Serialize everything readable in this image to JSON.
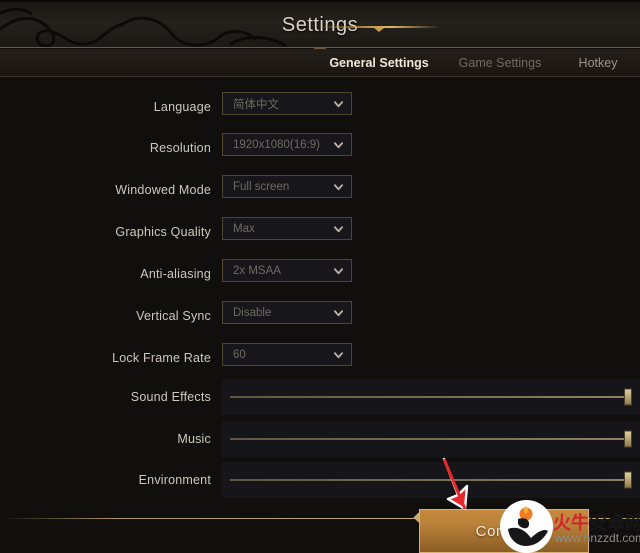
{
  "header": {
    "title": "Settings",
    "swirl_icon": "ornamental-swirl"
  },
  "tabs": [
    {
      "label": "General Settings",
      "active": true
    },
    {
      "label": "Game Settings",
      "active": false
    },
    {
      "label": "Hotkey",
      "active": false
    }
  ],
  "dropdown_rows": [
    {
      "label": "Language",
      "value": "简体中文",
      "icon": "chevron-down-icon"
    },
    {
      "label": "Resolution",
      "value": "1920x1080(16:9)",
      "icon": "chevron-down-icon"
    },
    {
      "label": "Windowed Mode",
      "value": "Full screen",
      "icon": "chevron-down-icon"
    },
    {
      "label": "Graphics Quality",
      "value": "Max",
      "icon": "chevron-down-icon"
    },
    {
      "label": "Anti-aliasing",
      "value": "2x MSAA",
      "icon": "chevron-down-icon"
    },
    {
      "label": "Vertical Sync",
      "value": "Disable",
      "icon": "chevron-down-icon"
    },
    {
      "label": "Lock Frame Rate",
      "value": "60",
      "icon": "chevron-down-icon"
    }
  ],
  "slider_rows": [
    {
      "label": "Sound Effects",
      "value": 100
    },
    {
      "label": "Music",
      "value": 100
    },
    {
      "label": "Environment",
      "value": 100
    }
  ],
  "footer": {
    "confirm_label": "Confirm"
  },
  "annotation": {
    "arrow_icon": "red-arrow-down-right",
    "arrow_color": "#e8262c"
  },
  "watermark": {
    "logo_icon": "bull-logo-icon",
    "name_red": "火牛",
    "name_black": "安卓网",
    "url": "www.hnzzdt.com"
  },
  "colors": {
    "background": "#100f0d",
    "accent_gold": "#c7ab72",
    "confirm_gold": "#b9813a",
    "text_primary": "#cfc8bc",
    "text_muted": "#6e6a63"
  }
}
